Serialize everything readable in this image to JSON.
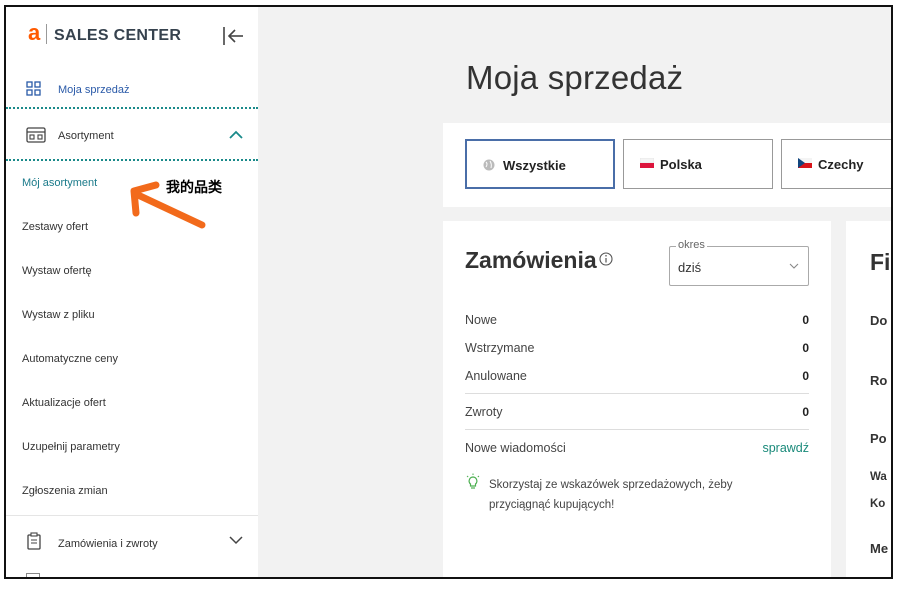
{
  "app": {
    "logo_letter": "a",
    "logo_text": "SALES CENTER"
  },
  "sidebar": {
    "top_item": {
      "label": "Moja sprzedaż",
      "icon": "grid-icon"
    },
    "group": {
      "label": "Asortyment",
      "icon": "store-icon",
      "expanded": true
    },
    "sub_items": [
      {
        "label": "Mój asortyment",
        "active": true
      },
      {
        "label": "Zestawy ofert"
      },
      {
        "label": "Wystaw ofertę"
      },
      {
        "label": "Wystaw z pliku"
      },
      {
        "label": "Automatyczne ceny"
      },
      {
        "label": "Aktualizacje ofert"
      },
      {
        "label": "Uzupełnij parametry"
      },
      {
        "label": "Zgłoszenia zmian"
      }
    ],
    "bottom_item": {
      "label": "Zamówienia i zwroty",
      "icon": "clipboard-icon"
    }
  },
  "annotation": {
    "text": "我的品类",
    "color": "#f26a1b"
  },
  "main": {
    "page_title": "Moja sprzedaż",
    "countries": [
      {
        "label": "Wszystkie",
        "icon": "globe-icon",
        "selected": true
      },
      {
        "label": "Polska",
        "icon": "flag-pl-icon"
      },
      {
        "label": "Czechy",
        "icon": "flag-cz-icon"
      }
    ],
    "orders": {
      "title": "Zamówienia",
      "period_legend": "okres",
      "period_value": "dziś",
      "rows": [
        {
          "label": "Nowe",
          "value": "0"
        },
        {
          "label": "Wstrzymane",
          "value": "0"
        },
        {
          "label": "Anulowane",
          "value": "0"
        },
        {
          "label": "Zwroty",
          "value": "0"
        }
      ],
      "messages_label": "Nowe wiadomości",
      "messages_link": "sprawdź",
      "tip_text": "Skorzystaj ze wskazówek sprzedażowych, żeby przyciągnąć kupujących!"
    },
    "finance_card": {
      "title": "Fi",
      "labels": [
        "Do",
        "Ro",
        "Po",
        "Wa",
        "Ko",
        "Me"
      ]
    }
  },
  "colors": {
    "brand": "#ff5a00",
    "accent_teal": "#1a8a8a",
    "link": "#1a8a7a",
    "selected_border": "#4a6ea8"
  }
}
